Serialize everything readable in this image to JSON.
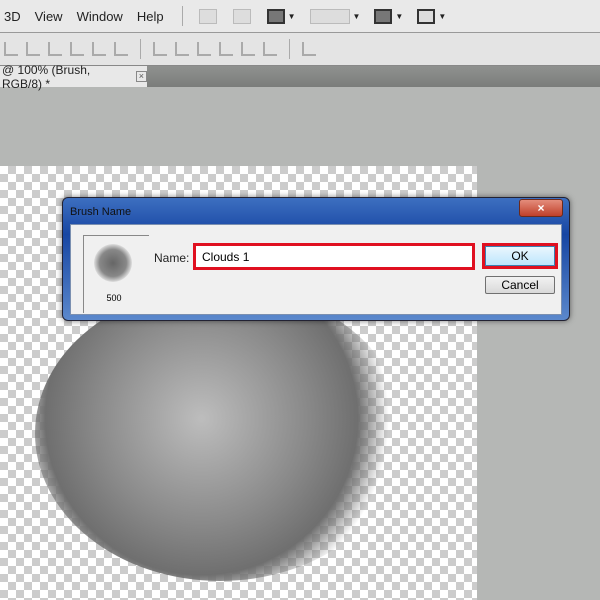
{
  "menu": {
    "items": [
      "3D",
      "View",
      "Window",
      "Help"
    ]
  },
  "document_tab": {
    "title": "@ 100% (Brush, RGB/8) *",
    "close": "×"
  },
  "dialog": {
    "title": "Brush Name",
    "close": "×",
    "name_label": "Name:",
    "name_value": "Clouds 1",
    "brush_size": "500",
    "ok": "OK",
    "cancel": "Cancel"
  },
  "colors": {
    "highlight": "#e01020",
    "title_bar": "#1746a3"
  }
}
